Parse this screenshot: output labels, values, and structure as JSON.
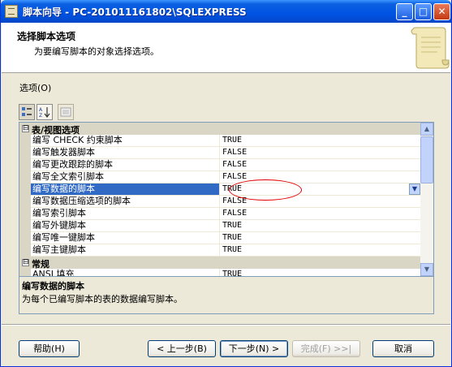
{
  "window": {
    "title": "脚本向导 - PC-201011161802\\SQLEXPRESS"
  },
  "header": {
    "title": "选择脚本选项",
    "subtitle": "为要编写脚本的对象选择选项。"
  },
  "options_label": "选项(O)",
  "grid": {
    "categories": [
      {
        "label": "表/视图选项",
        "toggle": "⊟",
        "properties": [
          {
            "name": "编写 CHECK 约束脚本",
            "value": "TRUE"
          },
          {
            "name": "编写触发器脚本",
            "value": "FALSE"
          },
          {
            "name": "编写更改跟踪的脚本",
            "value": "FALSE"
          },
          {
            "name": "编写全文索引脚本",
            "value": "FALSE"
          },
          {
            "name": "编写数据的脚本",
            "value": "TRUE",
            "selected": true
          },
          {
            "name": "编写数据压缩选项的脚本",
            "value": "FALSE"
          },
          {
            "name": "编写索引脚本",
            "value": "FALSE"
          },
          {
            "name": "编写外键脚本",
            "value": "TRUE"
          },
          {
            "name": "编写唯一键脚本",
            "value": "TRUE"
          },
          {
            "name": "编写主键脚本",
            "value": "TRUE"
          }
        ]
      },
      {
        "label": "常规",
        "toggle": "⊟",
        "properties": [
          {
            "name": "ANSI 填充",
            "value": "TRUE"
          }
        ]
      }
    ]
  },
  "description": {
    "title": "编写数据的脚本",
    "text": "为每个已编写脚本的表的数据编写脚本。"
  },
  "buttons": {
    "help": "帮助(H)",
    "back": "< 上一步(B)",
    "next": "下一步(N) >",
    "finish": "完成(F) >>|",
    "cancel": "取消"
  },
  "colors": {
    "selection": "#316ac5",
    "annotation": "#e00000",
    "titlebar": "#0054e3"
  }
}
